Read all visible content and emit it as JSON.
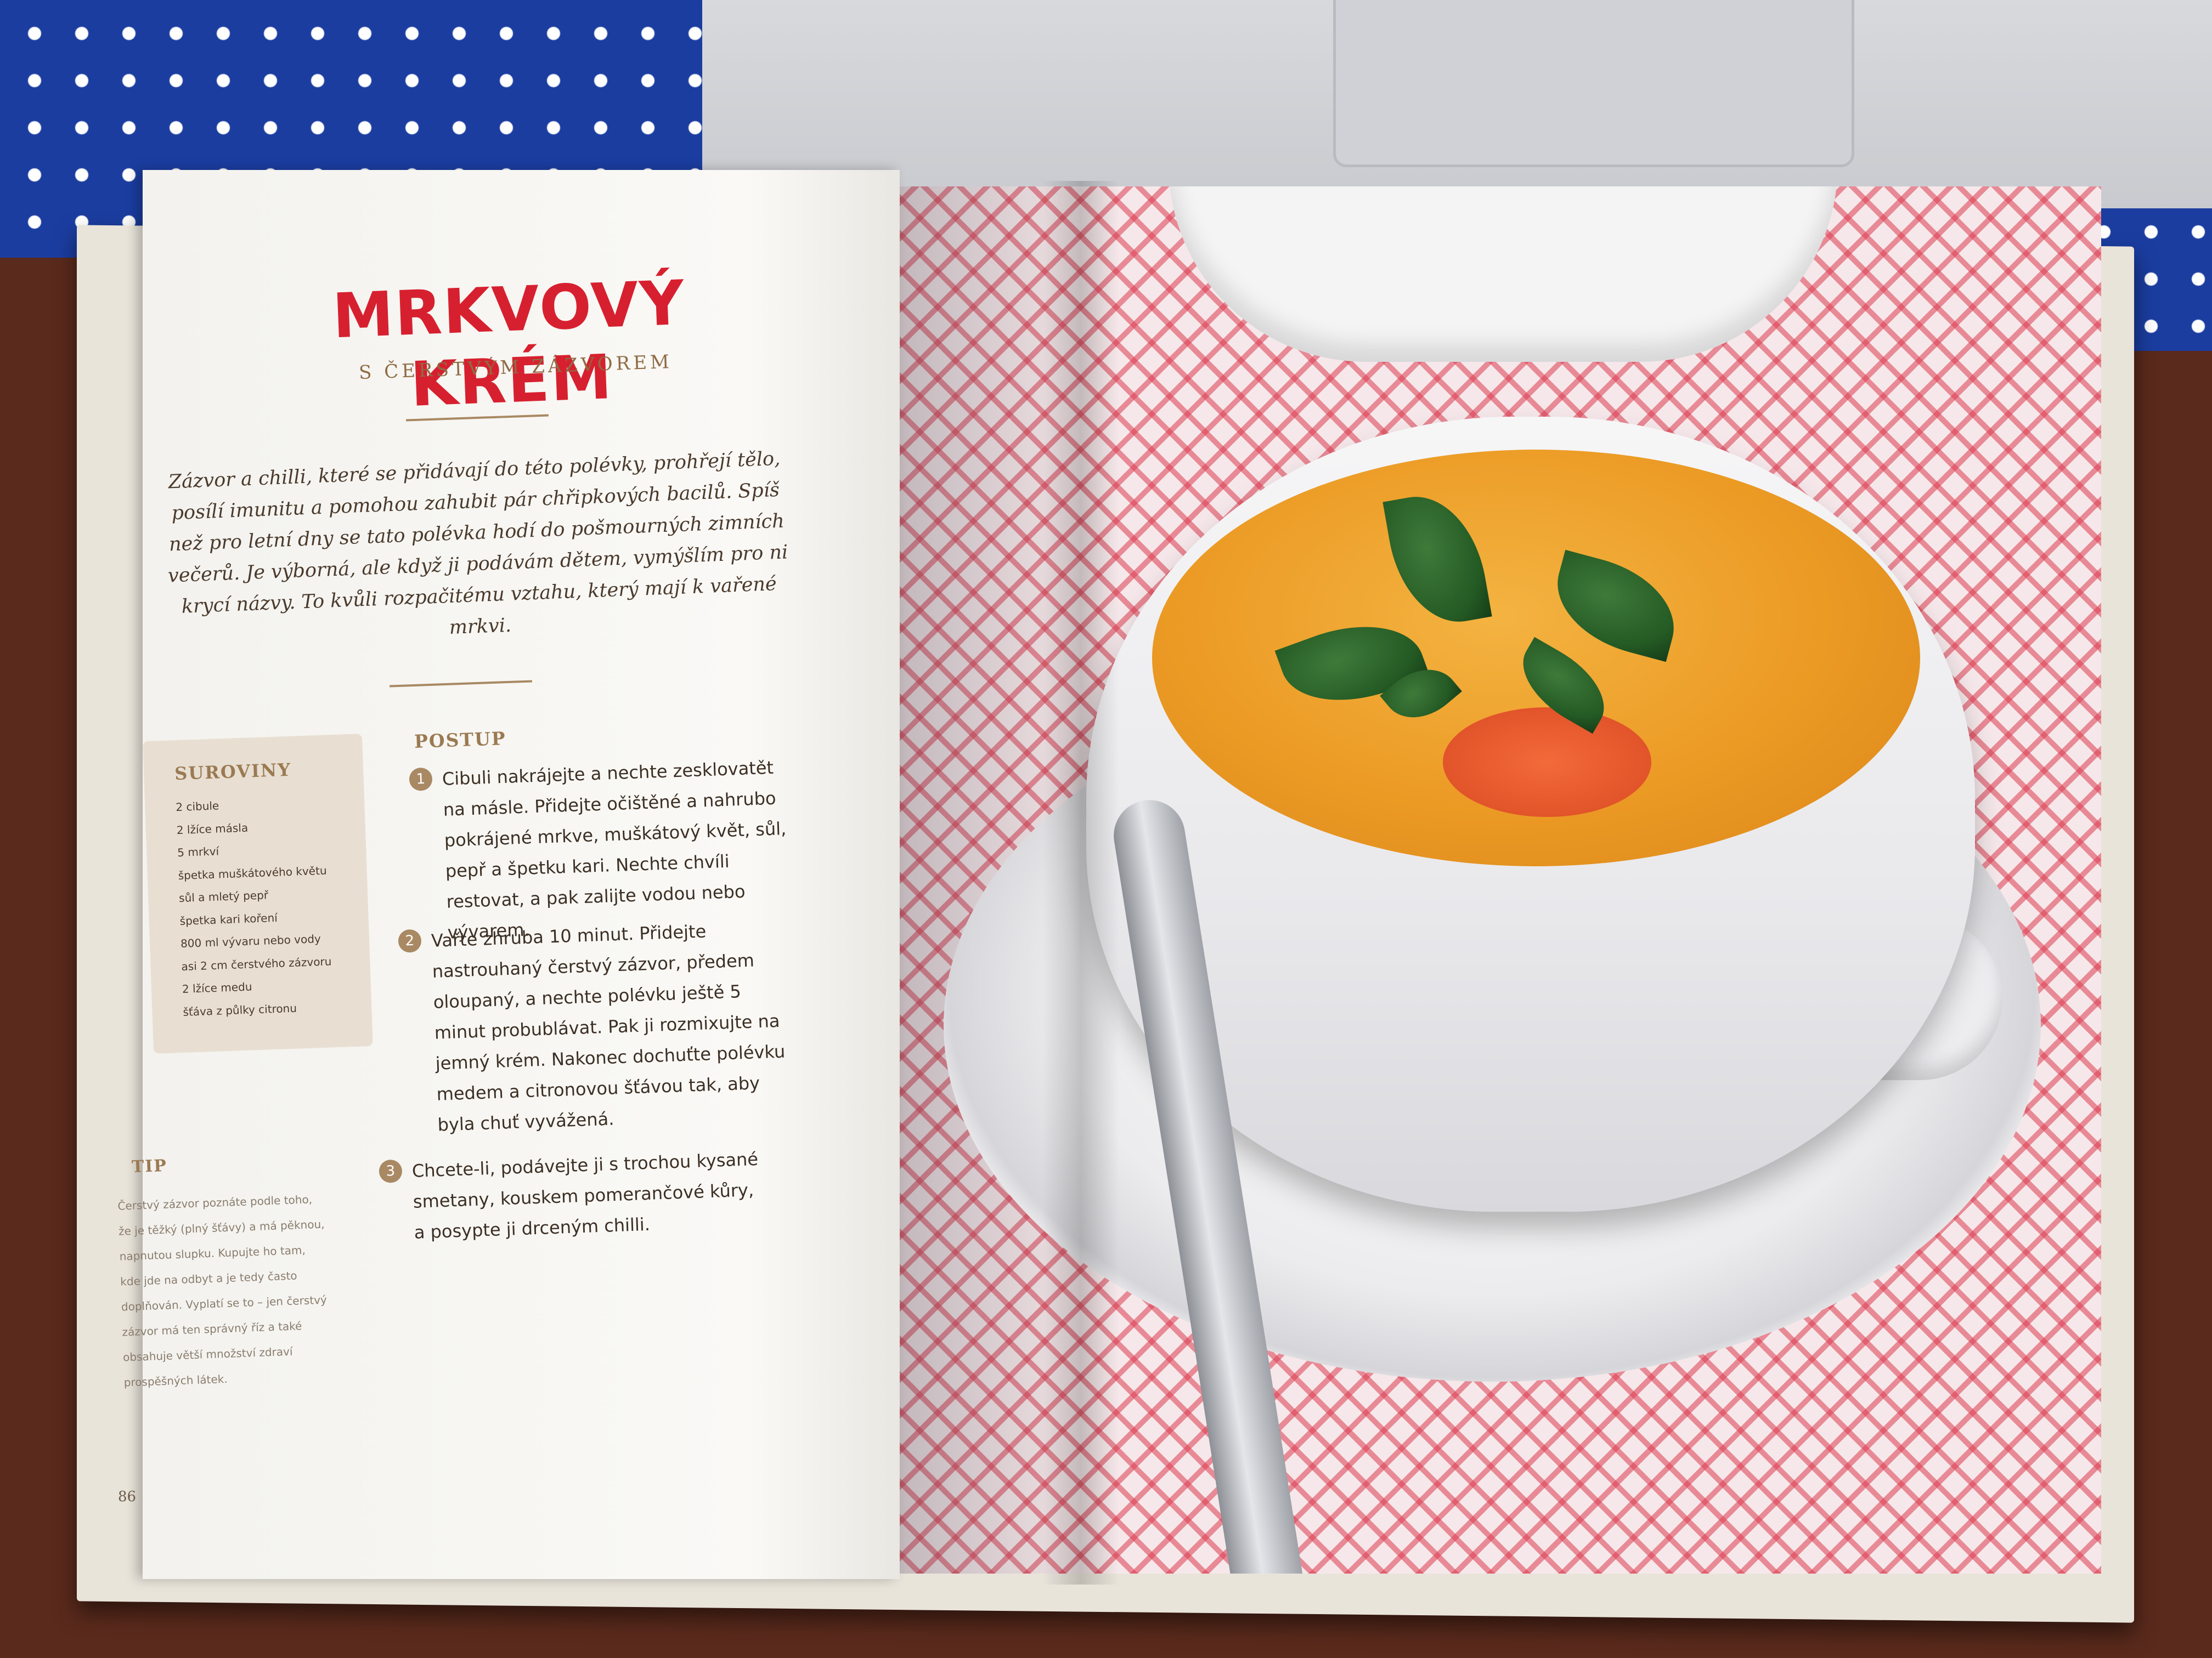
{
  "recipe": {
    "title": "MRKVOVÝ KRÉM",
    "subtitle": "S ČERSTVÝM ZÁZVOREM",
    "intro": "Zázvor a chilli, které se přidávají do této polévky, prohřejí tělo, posílí imunitu a pomohou zahubit pár chřipkových bacilů. Spíš než pro letní dny se tato polévka hodí do pošmourných zimních večerů. Je výborná, ale když ji podávám dětem, vymýšlím pro ni krycí názvy. To kvůli rozpačitému vztahu, který mají k vařené mrkvi."
  },
  "ingredients": {
    "heading": "SUROVINY",
    "items": [
      "2 cibule",
      "2 lžíce másla",
      "5 mrkví",
      "špetka muškátového květu",
      "sůl a mletý pepř",
      "špetka kari koření",
      "800 ml vývaru nebo vody",
      "asi 2 cm čerstvého zázvoru",
      "2 lžíce medu",
      "šťáva z půlky citronu"
    ]
  },
  "steps": {
    "heading": "POSTUP",
    "items": [
      {
        "num": "1",
        "text": "Cibuli nakrájejte a nechte zesklovatět na másle. Přidejte očištěné a nahrubo pokrájené mrkve, muškátový květ, sůl, pepř a špetku kari. Nechte chvíli restovat, a pak zalijte vodou nebo vývarem."
      },
      {
        "num": "2",
        "text": "Vařte zhruba 10 minut. Přidejte nastrouhaný čerstvý zázvor, předem oloupaný, a nechte polévku ještě 5 minut probublávat. Pak ji rozmixujte na jemný krém. Nakonec dochuťte polévku medem a citronovou šťávou tak, aby byla chuť vyvážená."
      },
      {
        "num": "3",
        "text": "Chcete-li, podávejte ji s trochou kysané smetany, kouskem pomerančové kůry, a posypte ji drceným chilli."
      }
    ]
  },
  "tip": {
    "heading": "TIP",
    "text": "Čerstvý zázvor poznáte podle toho, že je těžký (plný šťávy) a má pěknou, napnutou slupku. Kupujte ho tam, kde jde na odbyt a je tedy často doplňován. Vyplatí se to – jen čerstvý zázvor má ten správný říz a také obsahuje větší množství zdraví prospěšných látek."
  },
  "page_number": "86",
  "colors": {
    "title": "#d7202f",
    "accent": "#a98963",
    "soup": "#eb9a24",
    "tablecloth": "#1b3da0"
  }
}
